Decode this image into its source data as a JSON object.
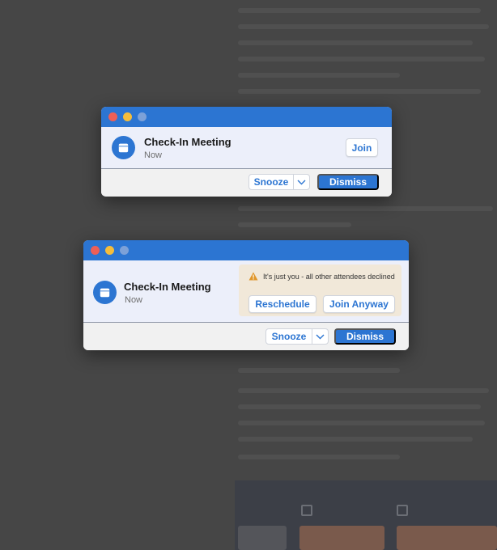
{
  "notifications": [
    {
      "title": "Check-In Meeting",
      "time": "Now",
      "join_label": "Join",
      "snooze_label": "Snooze",
      "dismiss_label": "Dismiss"
    },
    {
      "title": "Check-In Meeting",
      "time": "Now",
      "warning": "It's just you - all other attendees declined",
      "reschedule_label": "Reschedule",
      "join_anyway_label": "Join Anyway",
      "snooze_label": "Snooze",
      "dismiss_label": "Dismiss"
    }
  ],
  "colors": {
    "accent": "#2c75d2",
    "close": "#ee5f57",
    "minimize": "#f5bd3b",
    "warning_bg": "#f1e8d9",
    "warning_icon": "#e0962a"
  },
  "icons": [
    "calendar-icon",
    "warning-icon",
    "chevron-down-icon"
  ]
}
